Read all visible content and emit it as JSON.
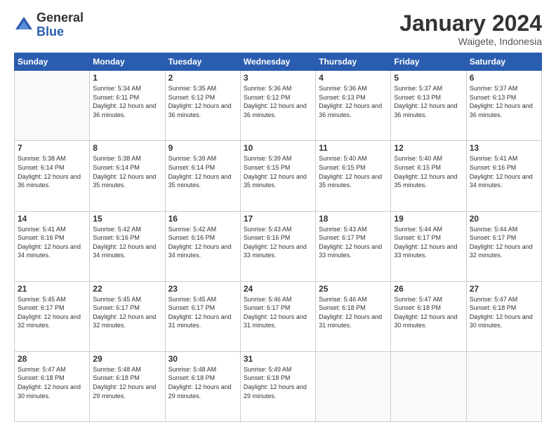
{
  "header": {
    "logo_general": "General",
    "logo_blue": "Blue",
    "month_title": "January 2024",
    "subtitle": "Waigete, Indonesia"
  },
  "days_of_week": [
    "Sunday",
    "Monday",
    "Tuesday",
    "Wednesday",
    "Thursday",
    "Friday",
    "Saturday"
  ],
  "weeks": [
    [
      {
        "num": "",
        "info": ""
      },
      {
        "num": "1",
        "info": "Sunrise: 5:34 AM\nSunset: 6:11 PM\nDaylight: 12 hours and 36 minutes."
      },
      {
        "num": "2",
        "info": "Sunrise: 5:35 AM\nSunset: 6:12 PM\nDaylight: 12 hours and 36 minutes."
      },
      {
        "num": "3",
        "info": "Sunrise: 5:36 AM\nSunset: 6:12 PM\nDaylight: 12 hours and 36 minutes."
      },
      {
        "num": "4",
        "info": "Sunrise: 5:36 AM\nSunset: 6:13 PM\nDaylight: 12 hours and 36 minutes."
      },
      {
        "num": "5",
        "info": "Sunrise: 5:37 AM\nSunset: 6:13 PM\nDaylight: 12 hours and 36 minutes."
      },
      {
        "num": "6",
        "info": "Sunrise: 5:37 AM\nSunset: 6:13 PM\nDaylight: 12 hours and 36 minutes."
      }
    ],
    [
      {
        "num": "7",
        "info": "Sunrise: 5:38 AM\nSunset: 6:14 PM\nDaylight: 12 hours and 36 minutes."
      },
      {
        "num": "8",
        "info": "Sunrise: 5:38 AM\nSunset: 6:14 PM\nDaylight: 12 hours and 35 minutes."
      },
      {
        "num": "9",
        "info": "Sunrise: 5:39 AM\nSunset: 6:14 PM\nDaylight: 12 hours and 35 minutes."
      },
      {
        "num": "10",
        "info": "Sunrise: 5:39 AM\nSunset: 6:15 PM\nDaylight: 12 hours and 35 minutes."
      },
      {
        "num": "11",
        "info": "Sunrise: 5:40 AM\nSunset: 6:15 PM\nDaylight: 12 hours and 35 minutes."
      },
      {
        "num": "12",
        "info": "Sunrise: 5:40 AM\nSunset: 6:15 PM\nDaylight: 12 hours and 35 minutes."
      },
      {
        "num": "13",
        "info": "Sunrise: 5:41 AM\nSunset: 6:16 PM\nDaylight: 12 hours and 34 minutes."
      }
    ],
    [
      {
        "num": "14",
        "info": "Sunrise: 5:41 AM\nSunset: 6:16 PM\nDaylight: 12 hours and 34 minutes."
      },
      {
        "num": "15",
        "info": "Sunrise: 5:42 AM\nSunset: 6:16 PM\nDaylight: 12 hours and 34 minutes."
      },
      {
        "num": "16",
        "info": "Sunrise: 5:42 AM\nSunset: 6:16 PM\nDaylight: 12 hours and 34 minutes."
      },
      {
        "num": "17",
        "info": "Sunrise: 5:43 AM\nSunset: 6:16 PM\nDaylight: 12 hours and 33 minutes."
      },
      {
        "num": "18",
        "info": "Sunrise: 5:43 AM\nSunset: 6:17 PM\nDaylight: 12 hours and 33 minutes."
      },
      {
        "num": "19",
        "info": "Sunrise: 5:44 AM\nSunset: 6:17 PM\nDaylight: 12 hours and 33 minutes."
      },
      {
        "num": "20",
        "info": "Sunrise: 5:44 AM\nSunset: 6:17 PM\nDaylight: 12 hours and 32 minutes."
      }
    ],
    [
      {
        "num": "21",
        "info": "Sunrise: 5:45 AM\nSunset: 6:17 PM\nDaylight: 12 hours and 32 minutes."
      },
      {
        "num": "22",
        "info": "Sunrise: 5:45 AM\nSunset: 6:17 PM\nDaylight: 12 hours and 32 minutes."
      },
      {
        "num": "23",
        "info": "Sunrise: 5:45 AM\nSunset: 6:17 PM\nDaylight: 12 hours and 31 minutes."
      },
      {
        "num": "24",
        "info": "Sunrise: 5:46 AM\nSunset: 6:17 PM\nDaylight: 12 hours and 31 minutes."
      },
      {
        "num": "25",
        "info": "Sunrise: 5:46 AM\nSunset: 6:18 PM\nDaylight: 12 hours and 31 minutes."
      },
      {
        "num": "26",
        "info": "Sunrise: 5:47 AM\nSunset: 6:18 PM\nDaylight: 12 hours and 30 minutes."
      },
      {
        "num": "27",
        "info": "Sunrise: 5:47 AM\nSunset: 6:18 PM\nDaylight: 12 hours and 30 minutes."
      }
    ],
    [
      {
        "num": "28",
        "info": "Sunrise: 5:47 AM\nSunset: 6:18 PM\nDaylight: 12 hours and 30 minutes."
      },
      {
        "num": "29",
        "info": "Sunrise: 5:48 AM\nSunset: 6:18 PM\nDaylight: 12 hours and 29 minutes."
      },
      {
        "num": "30",
        "info": "Sunrise: 5:48 AM\nSunset: 6:18 PM\nDaylight: 12 hours and 29 minutes."
      },
      {
        "num": "31",
        "info": "Sunrise: 5:49 AM\nSunset: 6:18 PM\nDaylight: 12 hours and 29 minutes."
      },
      {
        "num": "",
        "info": ""
      },
      {
        "num": "",
        "info": ""
      },
      {
        "num": "",
        "info": ""
      }
    ]
  ]
}
